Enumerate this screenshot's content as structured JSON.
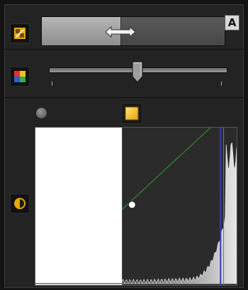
{
  "top_row": {
    "crop_icon": "crop-icon",
    "split_position": 0.43,
    "auto_label": "A"
  },
  "middle_row": {
    "color_icon": "color-palette-icon",
    "slider_value": 0.5
  },
  "curve": {
    "black_point_icon": "black-point-icon",
    "white_point_icon": "white-point-icon",
    "contrast_icon": "contrast-icon",
    "white_area_fraction": 0.43,
    "control_point": [
      0.48,
      0.49
    ]
  },
  "colors": {
    "accent": "#e8a800",
    "diagonal": "#2f8a2f",
    "histogram_line": "#3a3ab8"
  }
}
